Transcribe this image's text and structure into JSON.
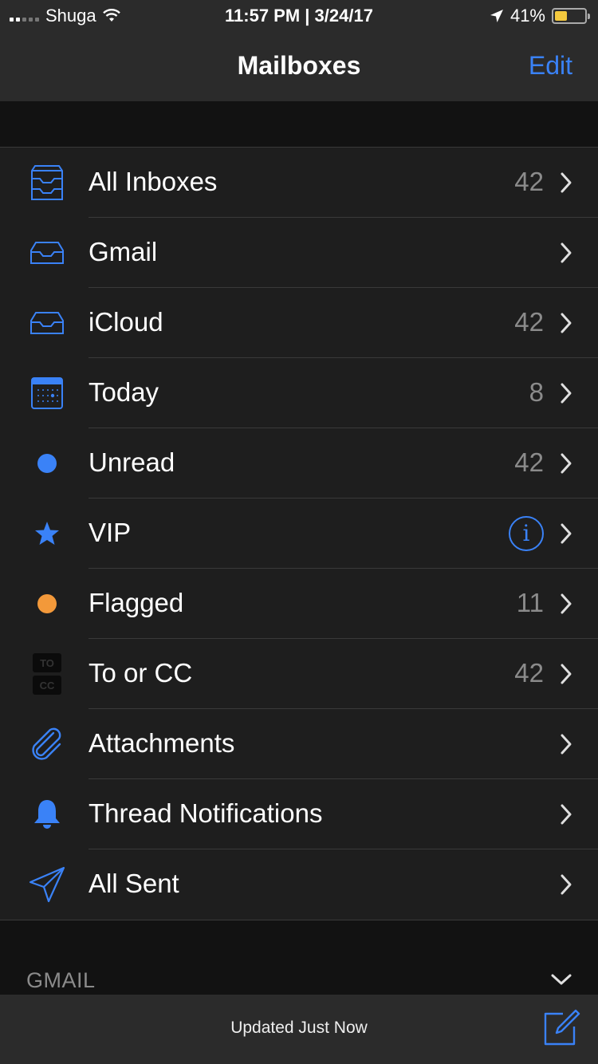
{
  "status_bar": {
    "carrier": "Shuga",
    "datetime": "11:57 PM | 3/24/17",
    "battery": "41%",
    "battery_level": 0.41
  },
  "nav": {
    "title": "Mailboxes",
    "edit_label": "Edit"
  },
  "mailboxes": [
    {
      "label": "All Inboxes",
      "count": "42",
      "icon": "all-inboxes-icon"
    },
    {
      "label": "Gmail",
      "count": "",
      "icon": "inbox-icon"
    },
    {
      "label": "iCloud",
      "count": "42",
      "icon": "inbox-icon"
    },
    {
      "label": "Today",
      "count": "8",
      "icon": "calendar-icon"
    },
    {
      "label": "Unread",
      "count": "42",
      "icon": "unread-dot-icon"
    },
    {
      "label": "VIP",
      "count": "",
      "icon": "star-icon"
    },
    {
      "label": "Flagged",
      "count": "11",
      "icon": "flag-dot-icon"
    },
    {
      "label": "To or CC",
      "count": "42",
      "icon": "to-cc-icon"
    },
    {
      "label": "Attachments",
      "count": "",
      "icon": "paperclip-icon"
    },
    {
      "label": "Thread Notifications",
      "count": "",
      "icon": "bell-icon"
    },
    {
      "label": "All Sent",
      "count": "",
      "icon": "paper-plane-icon"
    }
  ],
  "icon_labels": {
    "to": "TO",
    "cc": "CC",
    "info": "i"
  },
  "section": {
    "header": "GMAIL"
  },
  "toolbar": {
    "status": "Updated Just Now"
  },
  "colors": {
    "accent": "#3a82f7",
    "flag": "#f3993a",
    "background": "#1e1e1e"
  }
}
